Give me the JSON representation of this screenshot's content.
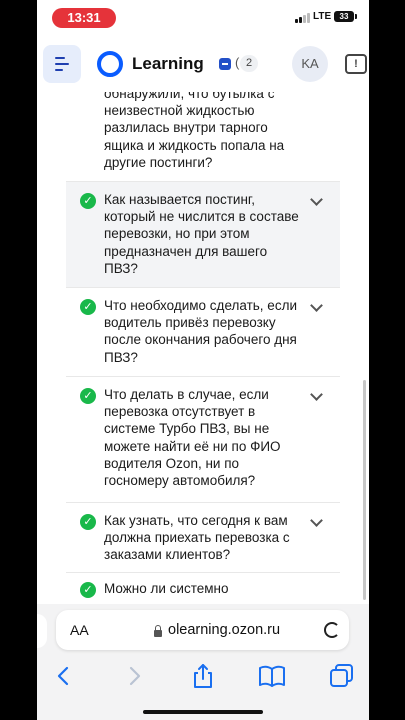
{
  "status_bar": {
    "time": "13:31",
    "network": "LTE",
    "battery": "33"
  },
  "header": {
    "brand": "Learning",
    "notifications_separator": "(",
    "notifications_count": "2",
    "avatar_initials": "KA",
    "accent_color": "#0a5cff"
  },
  "questions": {
    "partial_text": "обнаружили, что бутылка с неизвестной жидкостью разлилась внутри тарного ящика и жидкость попала на другие постинги?",
    "items": [
      {
        "text": "Как называется постинг, который не числится в составе перевозки, но при этом предназначен для вашего ПВЗ?"
      },
      {
        "text": "Что необходимо сделать, если водитель привёз перевозку после окончания рабочего дня ПВЗ?"
      },
      {
        "text": "Что делать в случае, если перевозка отсутствует в системе Турбо ПВЗ, вы не можете найти её ни по ФИО водителя Ozon, ни по госномеру автомобиля?"
      },
      {
        "text": "Как узнать, что сегодня к вам должна приехать перевозка с заказами клиентов?"
      },
      {
        "text": "Можно ли системно"
      }
    ],
    "check_color": "#19b84a"
  },
  "browser": {
    "text_size_label": "AA",
    "url": "olearning.ozon.ru"
  }
}
